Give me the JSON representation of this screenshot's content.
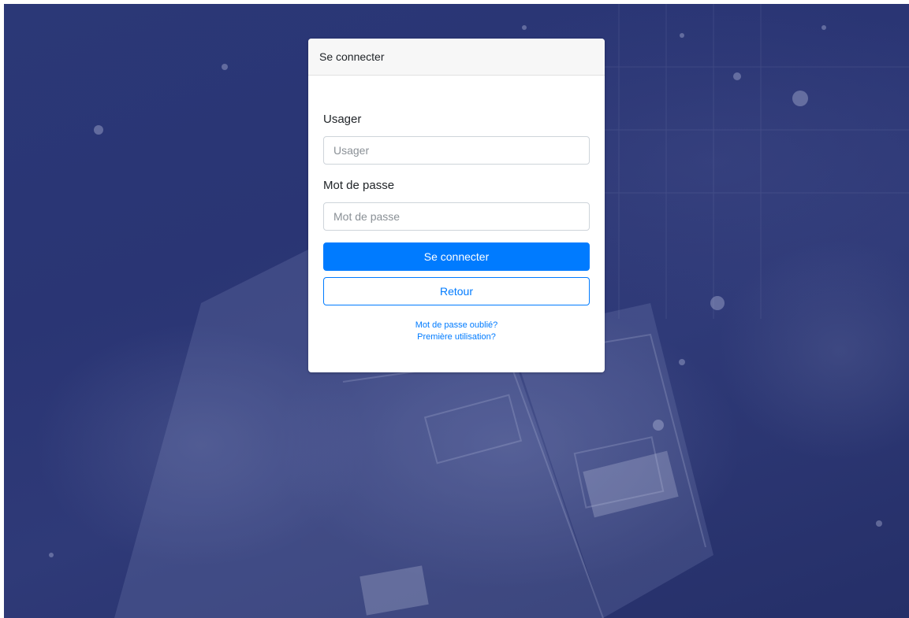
{
  "card": {
    "title": "Se connecter"
  },
  "form": {
    "username_label": "Usager",
    "username_placeholder": "Usager",
    "username_value": "",
    "password_label": "Mot de passe",
    "password_placeholder": "Mot de passe",
    "password_value": "",
    "submit_label": "Se connecter",
    "back_label": "Retour"
  },
  "links": {
    "forgot_password": "Mot de passe oublié?",
    "first_use": "Première utilisation?"
  },
  "colors": {
    "accent": "#007bff",
    "background": "#2b3877",
    "header_bg": "#f7f7f7"
  },
  "icons": {
    "background": "ambulance-photo-background"
  }
}
